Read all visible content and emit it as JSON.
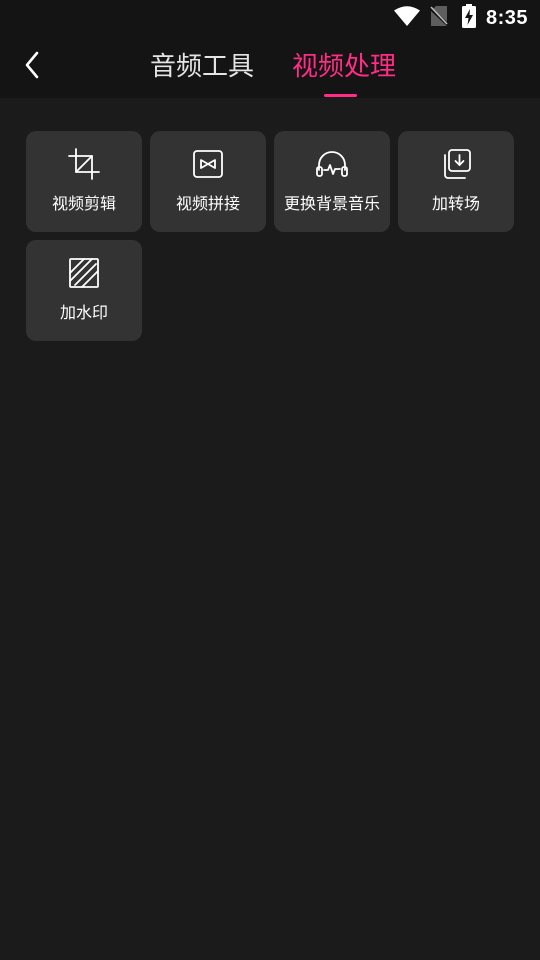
{
  "status_bar": {
    "time": "8:35",
    "icons": [
      "wifi-icon",
      "no-sim-icon",
      "battery-charging-icon"
    ]
  },
  "header": {
    "back_icon": "chevron-left-icon",
    "tabs": [
      {
        "label": "音频工具",
        "active": false
      },
      {
        "label": "视频处理",
        "active": true
      }
    ]
  },
  "tools": [
    {
      "label": "视频剪辑",
      "icon": "crop-icon"
    },
    {
      "label": "视频拼接",
      "icon": "join-video-icon"
    },
    {
      "label": "更换背景音乐",
      "icon": "headphones-audio-icon"
    },
    {
      "label": "加转场",
      "icon": "transition-icon"
    },
    {
      "label": "加水印",
      "icon": "watermark-icon"
    }
  ],
  "colors": {
    "background": "#1b1b1b",
    "header_background": "#141414",
    "card_background": "#333333",
    "accent": "#ff2d85",
    "inactive_tab": "#e4e4e4"
  }
}
